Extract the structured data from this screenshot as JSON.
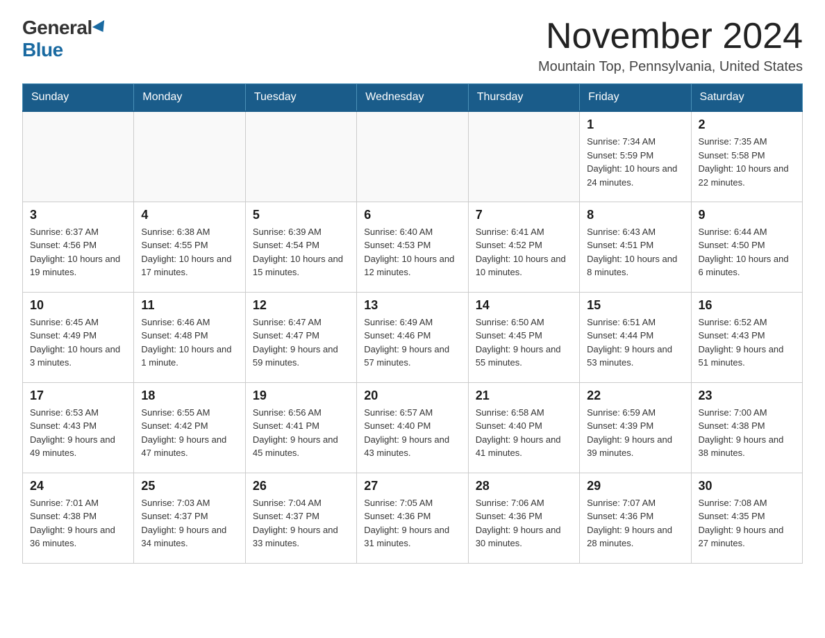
{
  "logo": {
    "general": "General",
    "blue": "Blue"
  },
  "title": "November 2024",
  "subtitle": "Mountain Top, Pennsylvania, United States",
  "days_of_week": [
    "Sunday",
    "Monday",
    "Tuesday",
    "Wednesday",
    "Thursday",
    "Friday",
    "Saturday"
  ],
  "weeks": [
    [
      {
        "day": "",
        "info": ""
      },
      {
        "day": "",
        "info": ""
      },
      {
        "day": "",
        "info": ""
      },
      {
        "day": "",
        "info": ""
      },
      {
        "day": "",
        "info": ""
      },
      {
        "day": "1",
        "info": "Sunrise: 7:34 AM\nSunset: 5:59 PM\nDaylight: 10 hours and 24 minutes."
      },
      {
        "day": "2",
        "info": "Sunrise: 7:35 AM\nSunset: 5:58 PM\nDaylight: 10 hours and 22 minutes."
      }
    ],
    [
      {
        "day": "3",
        "info": "Sunrise: 6:37 AM\nSunset: 4:56 PM\nDaylight: 10 hours and 19 minutes."
      },
      {
        "day": "4",
        "info": "Sunrise: 6:38 AM\nSunset: 4:55 PM\nDaylight: 10 hours and 17 minutes."
      },
      {
        "day": "5",
        "info": "Sunrise: 6:39 AM\nSunset: 4:54 PM\nDaylight: 10 hours and 15 minutes."
      },
      {
        "day": "6",
        "info": "Sunrise: 6:40 AM\nSunset: 4:53 PM\nDaylight: 10 hours and 12 minutes."
      },
      {
        "day": "7",
        "info": "Sunrise: 6:41 AM\nSunset: 4:52 PM\nDaylight: 10 hours and 10 minutes."
      },
      {
        "day": "8",
        "info": "Sunrise: 6:43 AM\nSunset: 4:51 PM\nDaylight: 10 hours and 8 minutes."
      },
      {
        "day": "9",
        "info": "Sunrise: 6:44 AM\nSunset: 4:50 PM\nDaylight: 10 hours and 6 minutes."
      }
    ],
    [
      {
        "day": "10",
        "info": "Sunrise: 6:45 AM\nSunset: 4:49 PM\nDaylight: 10 hours and 3 minutes."
      },
      {
        "day": "11",
        "info": "Sunrise: 6:46 AM\nSunset: 4:48 PM\nDaylight: 10 hours and 1 minute."
      },
      {
        "day": "12",
        "info": "Sunrise: 6:47 AM\nSunset: 4:47 PM\nDaylight: 9 hours and 59 minutes."
      },
      {
        "day": "13",
        "info": "Sunrise: 6:49 AM\nSunset: 4:46 PM\nDaylight: 9 hours and 57 minutes."
      },
      {
        "day": "14",
        "info": "Sunrise: 6:50 AM\nSunset: 4:45 PM\nDaylight: 9 hours and 55 minutes."
      },
      {
        "day": "15",
        "info": "Sunrise: 6:51 AM\nSunset: 4:44 PM\nDaylight: 9 hours and 53 minutes."
      },
      {
        "day": "16",
        "info": "Sunrise: 6:52 AM\nSunset: 4:43 PM\nDaylight: 9 hours and 51 minutes."
      }
    ],
    [
      {
        "day": "17",
        "info": "Sunrise: 6:53 AM\nSunset: 4:43 PM\nDaylight: 9 hours and 49 minutes."
      },
      {
        "day": "18",
        "info": "Sunrise: 6:55 AM\nSunset: 4:42 PM\nDaylight: 9 hours and 47 minutes."
      },
      {
        "day": "19",
        "info": "Sunrise: 6:56 AM\nSunset: 4:41 PM\nDaylight: 9 hours and 45 minutes."
      },
      {
        "day": "20",
        "info": "Sunrise: 6:57 AM\nSunset: 4:40 PM\nDaylight: 9 hours and 43 minutes."
      },
      {
        "day": "21",
        "info": "Sunrise: 6:58 AM\nSunset: 4:40 PM\nDaylight: 9 hours and 41 minutes."
      },
      {
        "day": "22",
        "info": "Sunrise: 6:59 AM\nSunset: 4:39 PM\nDaylight: 9 hours and 39 minutes."
      },
      {
        "day": "23",
        "info": "Sunrise: 7:00 AM\nSunset: 4:38 PM\nDaylight: 9 hours and 38 minutes."
      }
    ],
    [
      {
        "day": "24",
        "info": "Sunrise: 7:01 AM\nSunset: 4:38 PM\nDaylight: 9 hours and 36 minutes."
      },
      {
        "day": "25",
        "info": "Sunrise: 7:03 AM\nSunset: 4:37 PM\nDaylight: 9 hours and 34 minutes."
      },
      {
        "day": "26",
        "info": "Sunrise: 7:04 AM\nSunset: 4:37 PM\nDaylight: 9 hours and 33 minutes."
      },
      {
        "day": "27",
        "info": "Sunrise: 7:05 AM\nSunset: 4:36 PM\nDaylight: 9 hours and 31 minutes."
      },
      {
        "day": "28",
        "info": "Sunrise: 7:06 AM\nSunset: 4:36 PM\nDaylight: 9 hours and 30 minutes."
      },
      {
        "day": "29",
        "info": "Sunrise: 7:07 AM\nSunset: 4:36 PM\nDaylight: 9 hours and 28 minutes."
      },
      {
        "day": "30",
        "info": "Sunrise: 7:08 AM\nSunset: 4:35 PM\nDaylight: 9 hours and 27 minutes."
      }
    ]
  ]
}
